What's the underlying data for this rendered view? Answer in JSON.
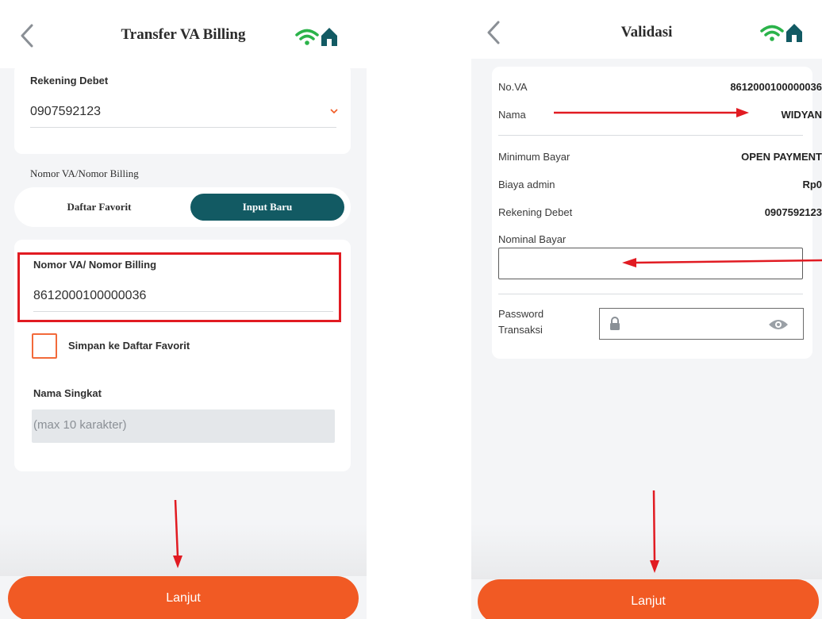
{
  "screen1": {
    "title": "Transfer VA Billing",
    "icons": {
      "back": "chevron-left-icon",
      "signal": "wifi-icon",
      "home": "home-icon"
    },
    "rekening_debet": {
      "label": "Rekening Debet",
      "value": "0907592123"
    },
    "va_section_label": "Nomor VA/Nomor Billing",
    "segments": [
      {
        "label": "Daftar Favorit",
        "selected": false
      },
      {
        "label": "Input Baru",
        "selected": true
      }
    ],
    "va_input": {
      "label": "Nomor VA/ Nomor Billing",
      "value": "8612000100000036"
    },
    "save_favorite": {
      "label": "Simpan ke Daftar Favorit",
      "checked": false
    },
    "nama_singkat": {
      "label": "Nama Singkat",
      "placeholder": "(max 10 karakter)"
    },
    "submit_label": "Lanjut"
  },
  "screen2": {
    "title": "Validasi",
    "icons": {
      "back": "chevron-left-icon",
      "signal": "wifi-icon",
      "home": "home-icon",
      "lock": "lock-icon",
      "eye": "eye-icon"
    },
    "rows_top": [
      {
        "label": "No.VA",
        "value": "8612000100000036"
      },
      {
        "label": "Nama",
        "value": "WIDYAN"
      }
    ],
    "rows_mid": [
      {
        "label": "Minimum Bayar",
        "value": "OPEN PAYMENT"
      },
      {
        "label": "Biaya admin",
        "value": "Rp0"
      },
      {
        "label": "Rekening Debet",
        "value": "0907592123"
      }
    ],
    "nominal_label": "Nominal Bayar",
    "nominal_value": "",
    "password_label_line1": "Password",
    "password_label_line2": "Transaksi",
    "submit_label": "Lanjut"
  },
  "colors": {
    "accent_orange": "#f15a24",
    "teal": "#125a63",
    "annotation_red": "#e11b22",
    "green_signal": "#2bb34a"
  }
}
